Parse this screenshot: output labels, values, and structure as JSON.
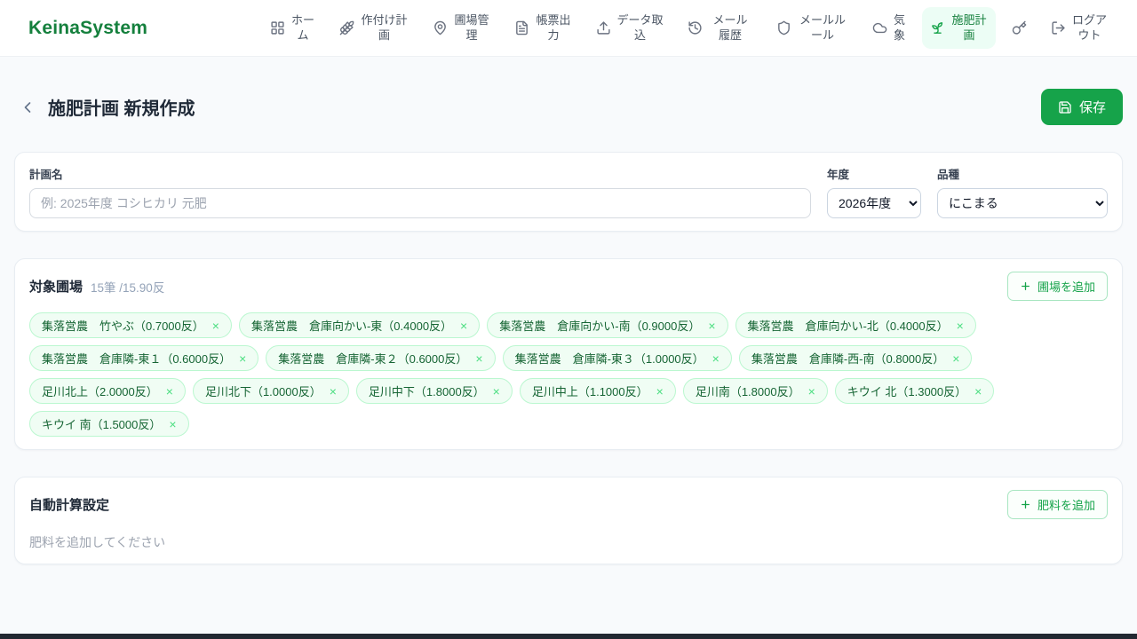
{
  "brand": {
    "name": "KeinaSystem"
  },
  "nav": {
    "items": [
      {
        "label": "ホーム"
      },
      {
        "label": "作付け計画"
      },
      {
        "label": "圃場管理"
      },
      {
        "label": "帳票出力"
      },
      {
        "label": "データ取込"
      },
      {
        "label": "メール履歴"
      },
      {
        "label": "メールルール"
      },
      {
        "label": "気象"
      },
      {
        "label": "施肥計画"
      },
      {
        "label": "ログアウト"
      }
    ]
  },
  "header": {
    "title": "施肥計画 新規作成",
    "save_label": "保存"
  },
  "plan_form": {
    "name_label": "計画名",
    "name_placeholder": "例: 2025年度 コシヒカリ 元肥",
    "year_label": "年度",
    "year_value": "2026年度",
    "variety_label": "品種",
    "variety_value": "にこまる"
  },
  "fields_section": {
    "title": "対象圃場",
    "count_text": "15筆 /15.90反",
    "add_button_label": "圃場を追加",
    "remove_symbol": "×",
    "tags": [
      "集落営農　竹やぶ（0.7000反）",
      "集落営農　倉庫向かい-東（0.4000反）",
      "集落営農　倉庫向かい-南（0.9000反）",
      "集落営農　倉庫向かい-北（0.4000反）",
      "集落営農　倉庫隣-東１（0.6000反）",
      "集落営農　倉庫隣-東２（0.6000反）",
      "集落営農　倉庫隣-東３（1.0000反）",
      "集落営農　倉庫隣-西-南（0.8000反）",
      "足川北上（2.0000反）",
      "足川北下（1.0000反）",
      "足川中下（1.8000反）",
      "足川中上（1.1000反）",
      "足川南（1.8000反）",
      "キウイ 北（1.3000反）",
      "キウイ 南（1.5000反）"
    ]
  },
  "auto_calc_section": {
    "title": "自動計算設定",
    "add_button_label": "肥料を追加",
    "empty_text": "肥料を追加してください"
  },
  "colors": {
    "brand_green": "#15803d",
    "accent_green": "#16a34a",
    "active_nav_bg": "#ecfdf5",
    "tag_bg": "#f0fdf4",
    "tag_border": "#bbf7d0",
    "tag_text": "#166534"
  }
}
